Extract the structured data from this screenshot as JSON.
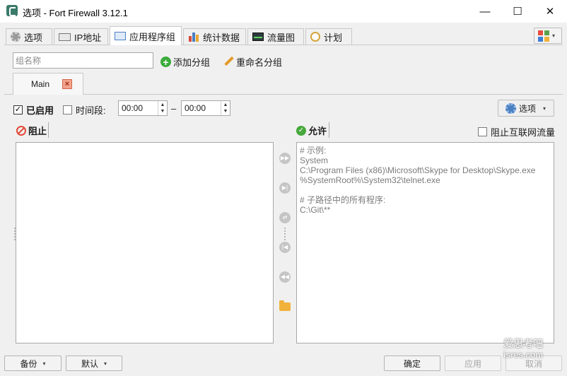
{
  "window": {
    "title": "选项 - Fort Firewall 3.12.1",
    "minimize_glyph": "—",
    "maximize_glyph": "☐",
    "close_glyph": "✕"
  },
  "tabs": [
    {
      "label": "选项",
      "icon": "gear-icon"
    },
    {
      "label": "IP地址",
      "icon": "ip-address-icon"
    },
    {
      "label": "应用程序组",
      "icon": "app-group-icon",
      "active": true
    },
    {
      "label": "统计数据",
      "icon": "statistics-icon"
    },
    {
      "label": "流量图",
      "icon": "traffic-graph-icon"
    },
    {
      "label": "计划",
      "icon": "clock-icon"
    }
  ],
  "toolbar": {
    "group_name_placeholder": "组名称",
    "add_group_label": "添加分组",
    "rename_group_label": "重命名分组"
  },
  "group_tab": {
    "label": "Main",
    "close_glyph": "×"
  },
  "settings_row": {
    "enabled_label": "已启用",
    "enabled_checked": true,
    "period_label": "时间段:",
    "period_checked": false,
    "time_from": "00:00",
    "time_dash": "–",
    "time_to": "00:00",
    "options_label": "选项"
  },
  "block_section": {
    "label": "阻止",
    "items": []
  },
  "allow_section": {
    "label": "允许",
    "block_internet_label": "阻止互联网流量",
    "block_internet_checked": false,
    "text": "# 示例:\nSystem\nC:\\Program Files (x86)\\Microsoft\\Skype for Desktop\\Skype.exe\n%SystemRoot%\\System32\\telnet.exe\n\n# 子路径中的所有程序:\nC:\\Git\\**"
  },
  "bottom": {
    "backup_label": "备份",
    "default_label": "默认",
    "ok_label": "确定",
    "apply_label": "应用",
    "cancel_label": "取消"
  },
  "watermark": {
    "line1": "爱思考吧",
    "line2": "isres.com"
  },
  "colors": {
    "accent_green": "#3bab3a",
    "block_red": "#e24b3a",
    "close_tab_bg": "#f3a38d"
  }
}
